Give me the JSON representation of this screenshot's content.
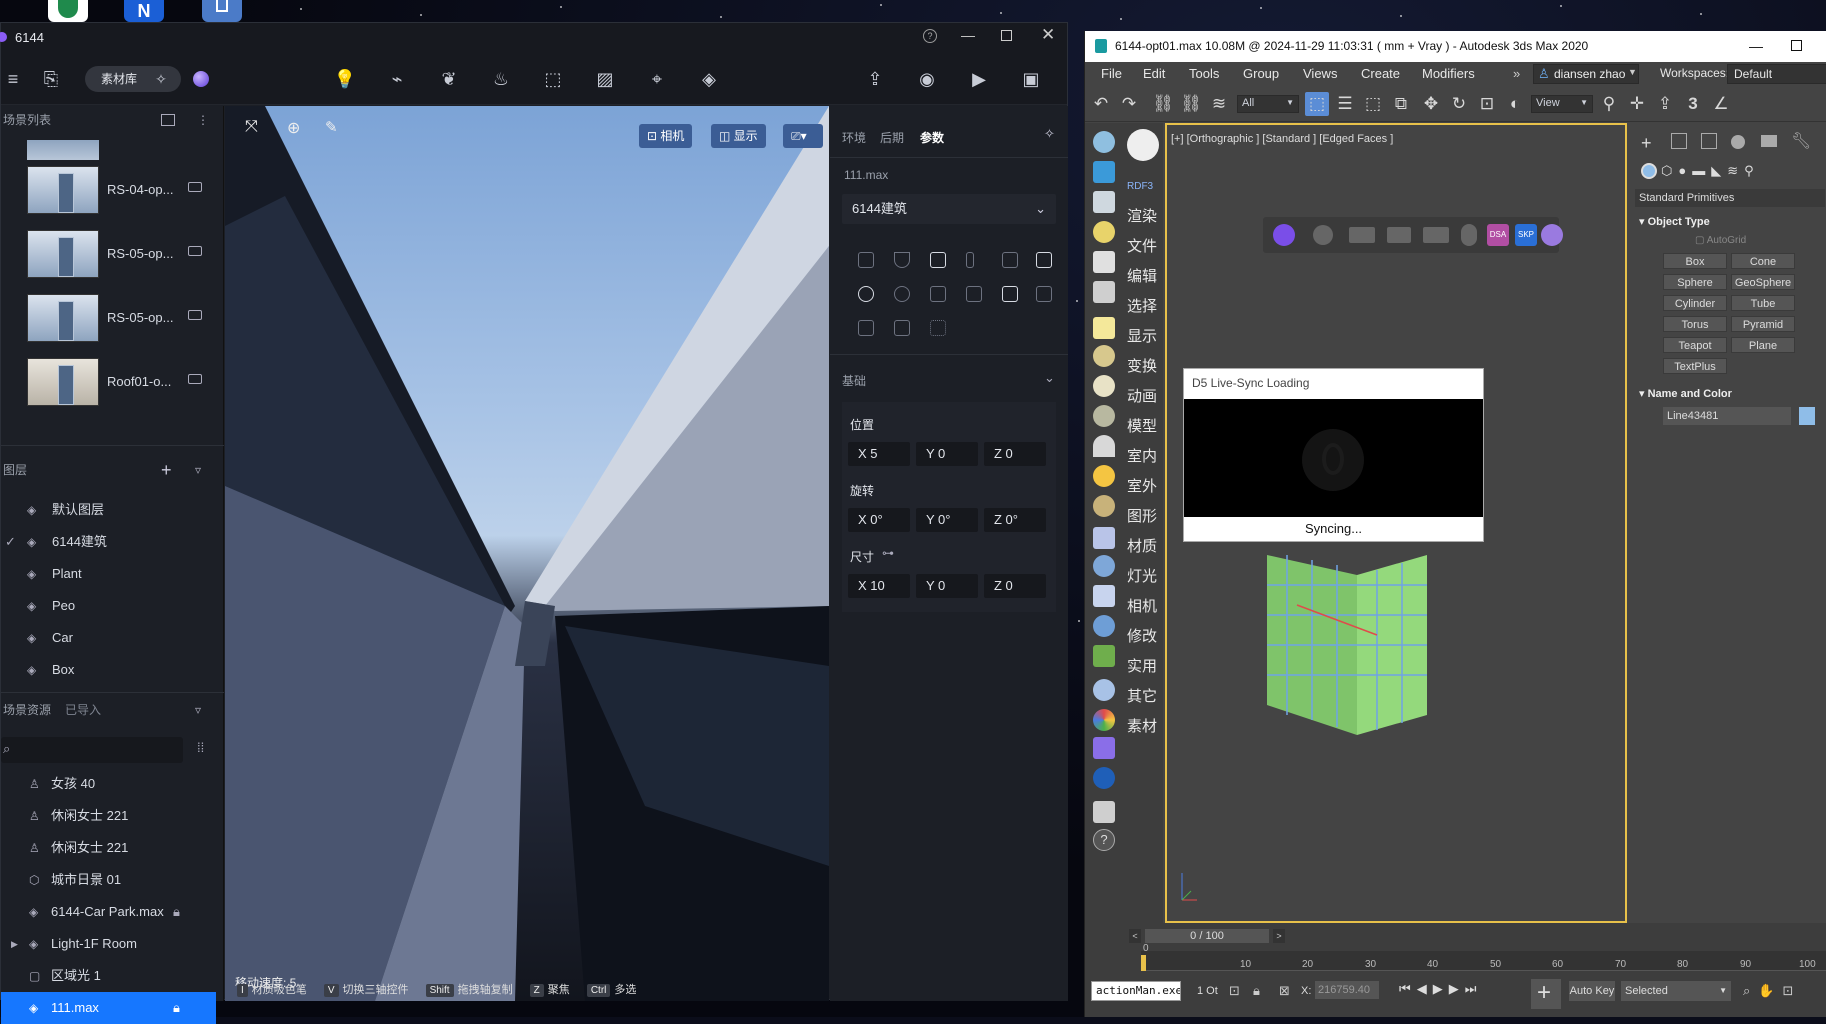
{
  "d5": {
    "window_title": "6144",
    "toolbar": {
      "library": "素材库"
    },
    "scene_list": {
      "title": "场景列表",
      "items": [
        {
          "label": "RS-04-op..."
        },
        {
          "label": "RS-05-op..."
        },
        {
          "label": "RS-05-op..."
        },
        {
          "label": "Roof01-o..."
        }
      ]
    },
    "layers": {
      "title": "图层",
      "items": [
        {
          "label": "默认图层",
          "checked": false
        },
        {
          "label": "6144建筑",
          "checked": true
        },
        {
          "label": "Plant",
          "checked": false
        },
        {
          "label": "Peo",
          "checked": false
        },
        {
          "label": "Car",
          "checked": false
        },
        {
          "label": "Box",
          "checked": false
        }
      ]
    },
    "resources": {
      "title": "场景资源",
      "tab_imported": "已导入",
      "items": [
        {
          "label": "女孩 40",
          "icon": "person-icon",
          "locked": false,
          "selected": false
        },
        {
          "label": "休闲女士 221",
          "icon": "person-icon",
          "locked": false,
          "selected": false
        },
        {
          "label": "休闲女士 221",
          "icon": "person-icon",
          "locked": false,
          "selected": false
        },
        {
          "label": "城市日景 01",
          "icon": "cube-icon",
          "locked": false,
          "selected": false
        },
        {
          "label": "6144-Car Park.max",
          "icon": "layers-icon",
          "locked": true,
          "selected": false
        },
        {
          "label": "Light-1F Room",
          "icon": "layers-icon",
          "locked": false,
          "selected": false
        },
        {
          "label": "区域光 1",
          "icon": "square-icon",
          "locked": false,
          "selected": false
        },
        {
          "label": "111.max",
          "icon": "layers-icon",
          "locked": true,
          "selected": true
        }
      ]
    },
    "viewport": {
      "btn_camera": "相机",
      "btn_display": "显示",
      "move_speed": "移动速度: 5",
      "hints": [
        {
          "key": "I",
          "text": "材质吸色笔"
        },
        {
          "key": "V",
          "text": "切换三轴控件"
        },
        {
          "key": "Shift",
          "text": "拖拽轴复制"
        },
        {
          "key": "Z",
          "text": "聚焦"
        },
        {
          "key": "Ctrl",
          "text": "多选"
        }
      ]
    },
    "props": {
      "tabs": [
        "环境",
        "后期",
        "参数"
      ],
      "file": "111.max",
      "layer_select": "6144建筑",
      "basic": "基础",
      "position": "位置",
      "pos": [
        "X 5",
        "Y 0",
        "Z 0"
      ],
      "rotation": "旋转",
      "rot": [
        "X 0°",
        "Y 0°",
        "Z 0°"
      ],
      "size": "尺寸",
      "sz": [
        "X 10",
        "Y 0",
        "Z 0"
      ]
    }
  },
  "max": {
    "title": "6144-opt01.max  10.08M @ 2024-11-29 11:03:31  ( mm + Vray ) - Autodesk 3ds Max 2020",
    "menu": [
      "File",
      "Edit",
      "Tools",
      "Group",
      "Views",
      "Create",
      "Modifiers"
    ],
    "user": "diansen zhao",
    "workspaces_label": "Workspaces:",
    "workspaces_value": "Default",
    "filter_all": "All",
    "view_drop": "View",
    "rdf3": "RDF3",
    "cn_menu": [
      "渲染",
      "文件",
      "编辑",
      "选择",
      "显示",
      "变换",
      "动画",
      "模型",
      "室内",
      "室外",
      "图形",
      "材质",
      "灯光",
      "相机",
      "修改",
      "实用",
      "其它",
      "素材"
    ],
    "viewport_label": "[+] [Orthographic ] [Standard ] [Edged Faces ]",
    "plugin_icons": [
      "d5-icon",
      "camera-icon",
      "skp-icon",
      "dsa-icon",
      "flower-icon"
    ],
    "panel": {
      "category": "Standard Primitives",
      "object_type": "Object Type",
      "autogrid": "AutoGrid",
      "buttons": [
        "Box",
        "Cone",
        "Sphere",
        "GeoSphere",
        "Cylinder",
        "Tube",
        "Torus",
        "Pyramid",
        "Teapot",
        "Plane",
        "TextPlus"
      ],
      "name_color": "Name and Color",
      "name_value": "Line43481",
      "color": "#8fbde8"
    },
    "timeline": {
      "frame": "0 / 100",
      "ticks": [
        "0",
        "10",
        "20",
        "30",
        "40",
        "50",
        "60",
        "70",
        "80",
        "90",
        "100"
      ]
    },
    "status": {
      "script": "actionMan.exe",
      "count": "1 Ot",
      "x_label": "X:",
      "x_value": "216759.40",
      "autokey": "Auto Key",
      "selected": "Selected"
    }
  },
  "dialog": {
    "title": "D5 Live-Sync Loading",
    "status": "Syncing..."
  }
}
